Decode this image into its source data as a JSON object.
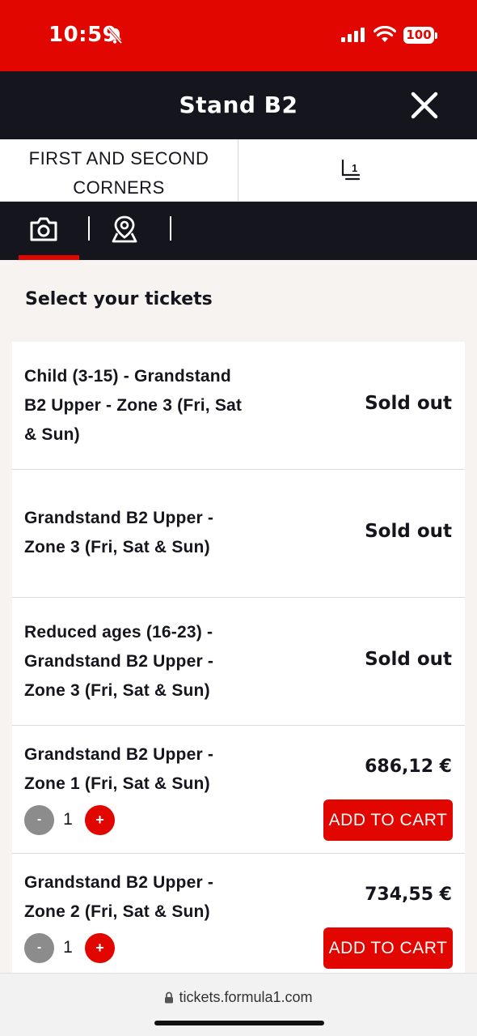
{
  "status_bar": {
    "time": "10:59",
    "battery": "100",
    "icons": [
      "bell-slash-icon",
      "signal-icon",
      "wifi-icon",
      "battery-icon"
    ]
  },
  "header": {
    "title": "Stand B2",
    "close_icon": "close-icon"
  },
  "info": {
    "section_line1": "FIRST AND SECOND",
    "section_line2": "CORNERS",
    "seat_icon": "seat-number-icon",
    "seat_number": "1"
  },
  "tabs": [
    {
      "icon": "camera-icon",
      "active": true
    },
    {
      "icon": "map-pin-icon",
      "active": false
    }
  ],
  "main": {
    "heading": "Select your tickets",
    "tickets": [
      {
        "name_lines": [
          "Child (3-15) - Grandstand",
          "B2 Upper - Zone 3 (Fri, Sat",
          "& Sun)"
        ],
        "status": "Sold out"
      },
      {
        "name_lines": [
          "Grandstand B2 Upper -",
          "Zone 3 (Fri, Sat & Sun)"
        ],
        "status": "Sold out"
      },
      {
        "name_lines": [
          "Reduced ages (16-23) -",
          "Grandstand B2 Upper -",
          "Zone 3 (Fri, Sat & Sun)"
        ],
        "status": "Sold out"
      },
      {
        "name_lines": [
          "Grandstand B2 Upper -",
          "Zone 1 (Fri, Sat & Sun)"
        ],
        "price": "686,12 €",
        "minus": "-",
        "qty": "1",
        "plus": "+",
        "button": "ADD TO CART"
      },
      {
        "name_lines": [
          "Grandstand B2 Upper -",
          "Zone 2 (Fri, Sat & Sun)"
        ],
        "price": "734,55 €",
        "minus": "-",
        "qty": "1",
        "plus": "+",
        "button": "ADD TO CART"
      }
    ]
  },
  "browser": {
    "url": "tickets.formula1.com"
  },
  "colors": {
    "brand_red": "#e10600",
    "dark": "#15151e",
    "background": "#f6f3f1"
  }
}
